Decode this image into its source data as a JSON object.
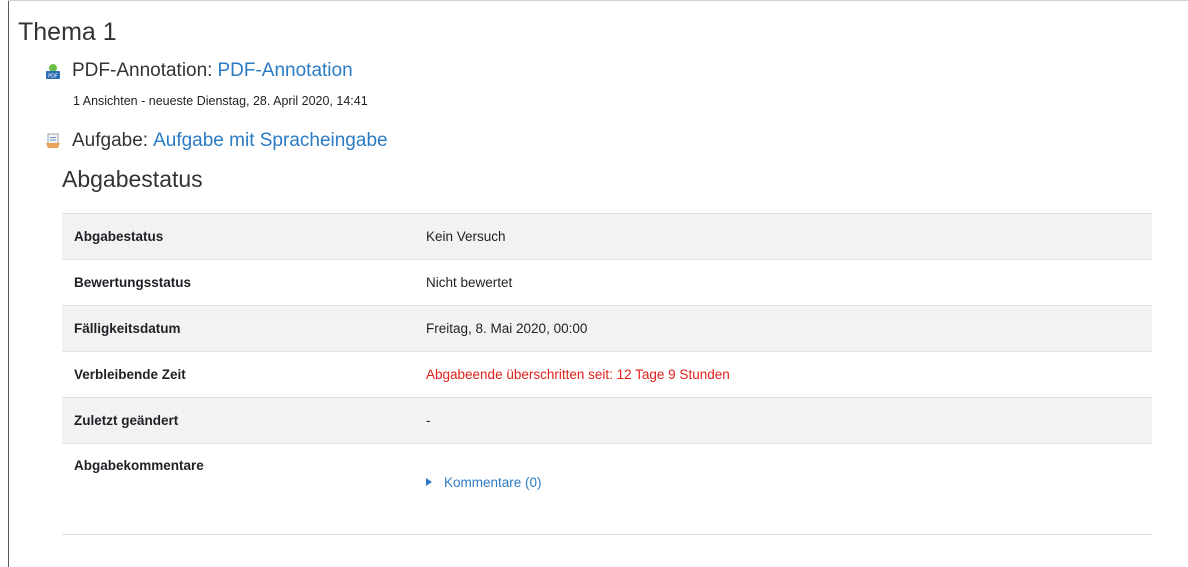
{
  "section": {
    "title": "Thema 1"
  },
  "activities": [
    {
      "type_label": "PDF-Annotation:",
      "name": "PDF-Annotation",
      "icon": "pdf-annotation-icon",
      "info": "1 Ansichten - neueste Dienstag, 28. April 2020, 14:41"
    },
    {
      "type_label": "Aufgabe:",
      "name": "Aufgabe mit Spracheingabe",
      "icon": "assignment-icon"
    }
  ],
  "submission": {
    "heading": "Abgabestatus",
    "rows": [
      {
        "label": "Abgabestatus",
        "value": "Kein Versuch"
      },
      {
        "label": "Bewertungsstatus",
        "value": "Nicht bewertet"
      },
      {
        "label": "Fälligkeitsdatum",
        "value": "Freitag, 8. Mai 2020, 00:00"
      },
      {
        "label": "Verbleibende Zeit",
        "value": "Abgabeende überschritten seit: 12 Tage 9 Stunden"
      },
      {
        "label": "Zuletzt geändert",
        "value": "-"
      },
      {
        "label": "Abgabekommentare",
        "value": "Kommentare (0)"
      }
    ]
  },
  "colors": {
    "link": "#2b7bc4",
    "overdue": "#e0201b",
    "stripe": "#f2f2f2"
  }
}
